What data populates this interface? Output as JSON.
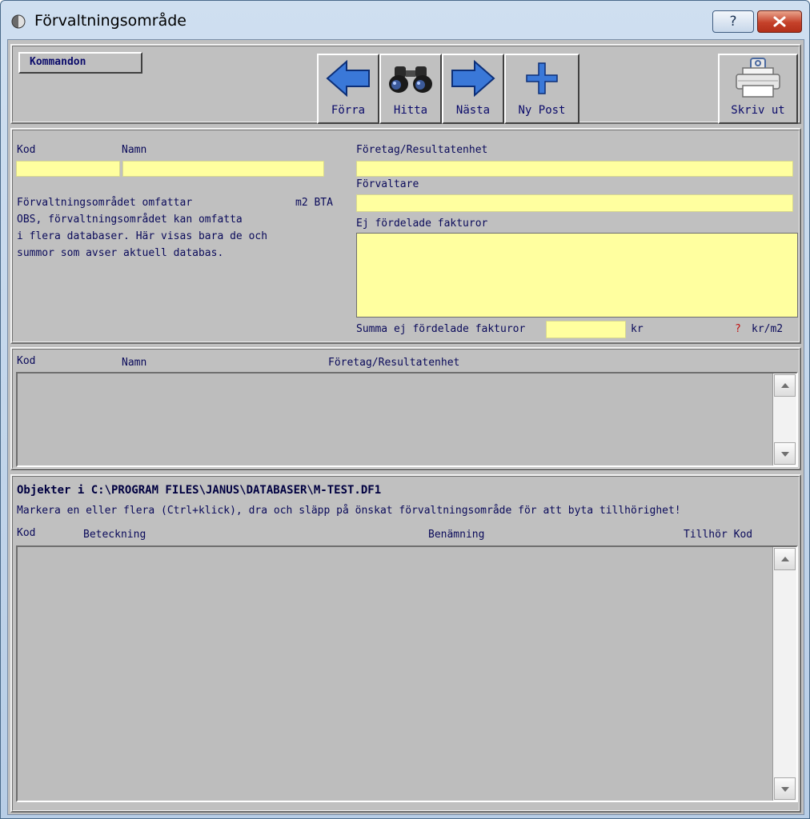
{
  "window": {
    "title": "Förvaltningsområde",
    "help_label": "?"
  },
  "toolbar": {
    "commands_label": "Kommandon",
    "prev_label": "Förra",
    "find_label": "Hitta",
    "next_label": "Nästa",
    "new_label": "Ny Post",
    "print_label": "Skriv ut"
  },
  "form": {
    "kod_label": "Kod",
    "namn_label": "Namn",
    "company_label": "Företag/Resultatenhet",
    "manager_label": "Förvaltare",
    "invoices_label": "Ej fördelade fakturor",
    "info_line1": "Förvaltningsområdet omfattar",
    "area_unit": "m2 BTA",
    "info_line2": "OBS, förvaltningsområdet kan omfatta",
    "info_line3": " i flera databaser. Här visas bara de  och",
    "info_line4": "summor som avser aktuell databas.",
    "sum_label": "Summa ej fördelade fakturor",
    "currency": "kr",
    "per_m2_marker": "?",
    "per_m2_unit": "kr/m2",
    "kod_value": "",
    "namn_value": "",
    "company_value": "",
    "manager_value": "",
    "sum_value": ""
  },
  "list1": {
    "columns": [
      "Kod",
      "Namn",
      "Företag/Resultatenhet"
    ]
  },
  "objects": {
    "heading": "Objekter i C:\\PROGRAM FILES\\JANUS\\DATABASER\\M-TEST.DF1",
    "hint": "Markera en eller flera (Ctrl+klick), dra och släpp på önskat förvaltningsområde för att byta tillhörighet!",
    "columns": [
      "Kod",
      "Beteckning",
      "Benämning",
      "Tillhör Kod"
    ]
  },
  "colors": {
    "field_yellow": "#ffff9f",
    "panel_gray": "#c0c0c0",
    "label_navy": "#0a0a5a",
    "arrow_blue": "#3a78d8",
    "close_red": "#c5412a",
    "marker_red": "#c01010"
  },
  "icons": {
    "prev": "arrow-left-icon",
    "find": "binoculars-icon",
    "next": "arrow-right-icon",
    "new": "plus-icon",
    "print": "printer-icon"
  }
}
